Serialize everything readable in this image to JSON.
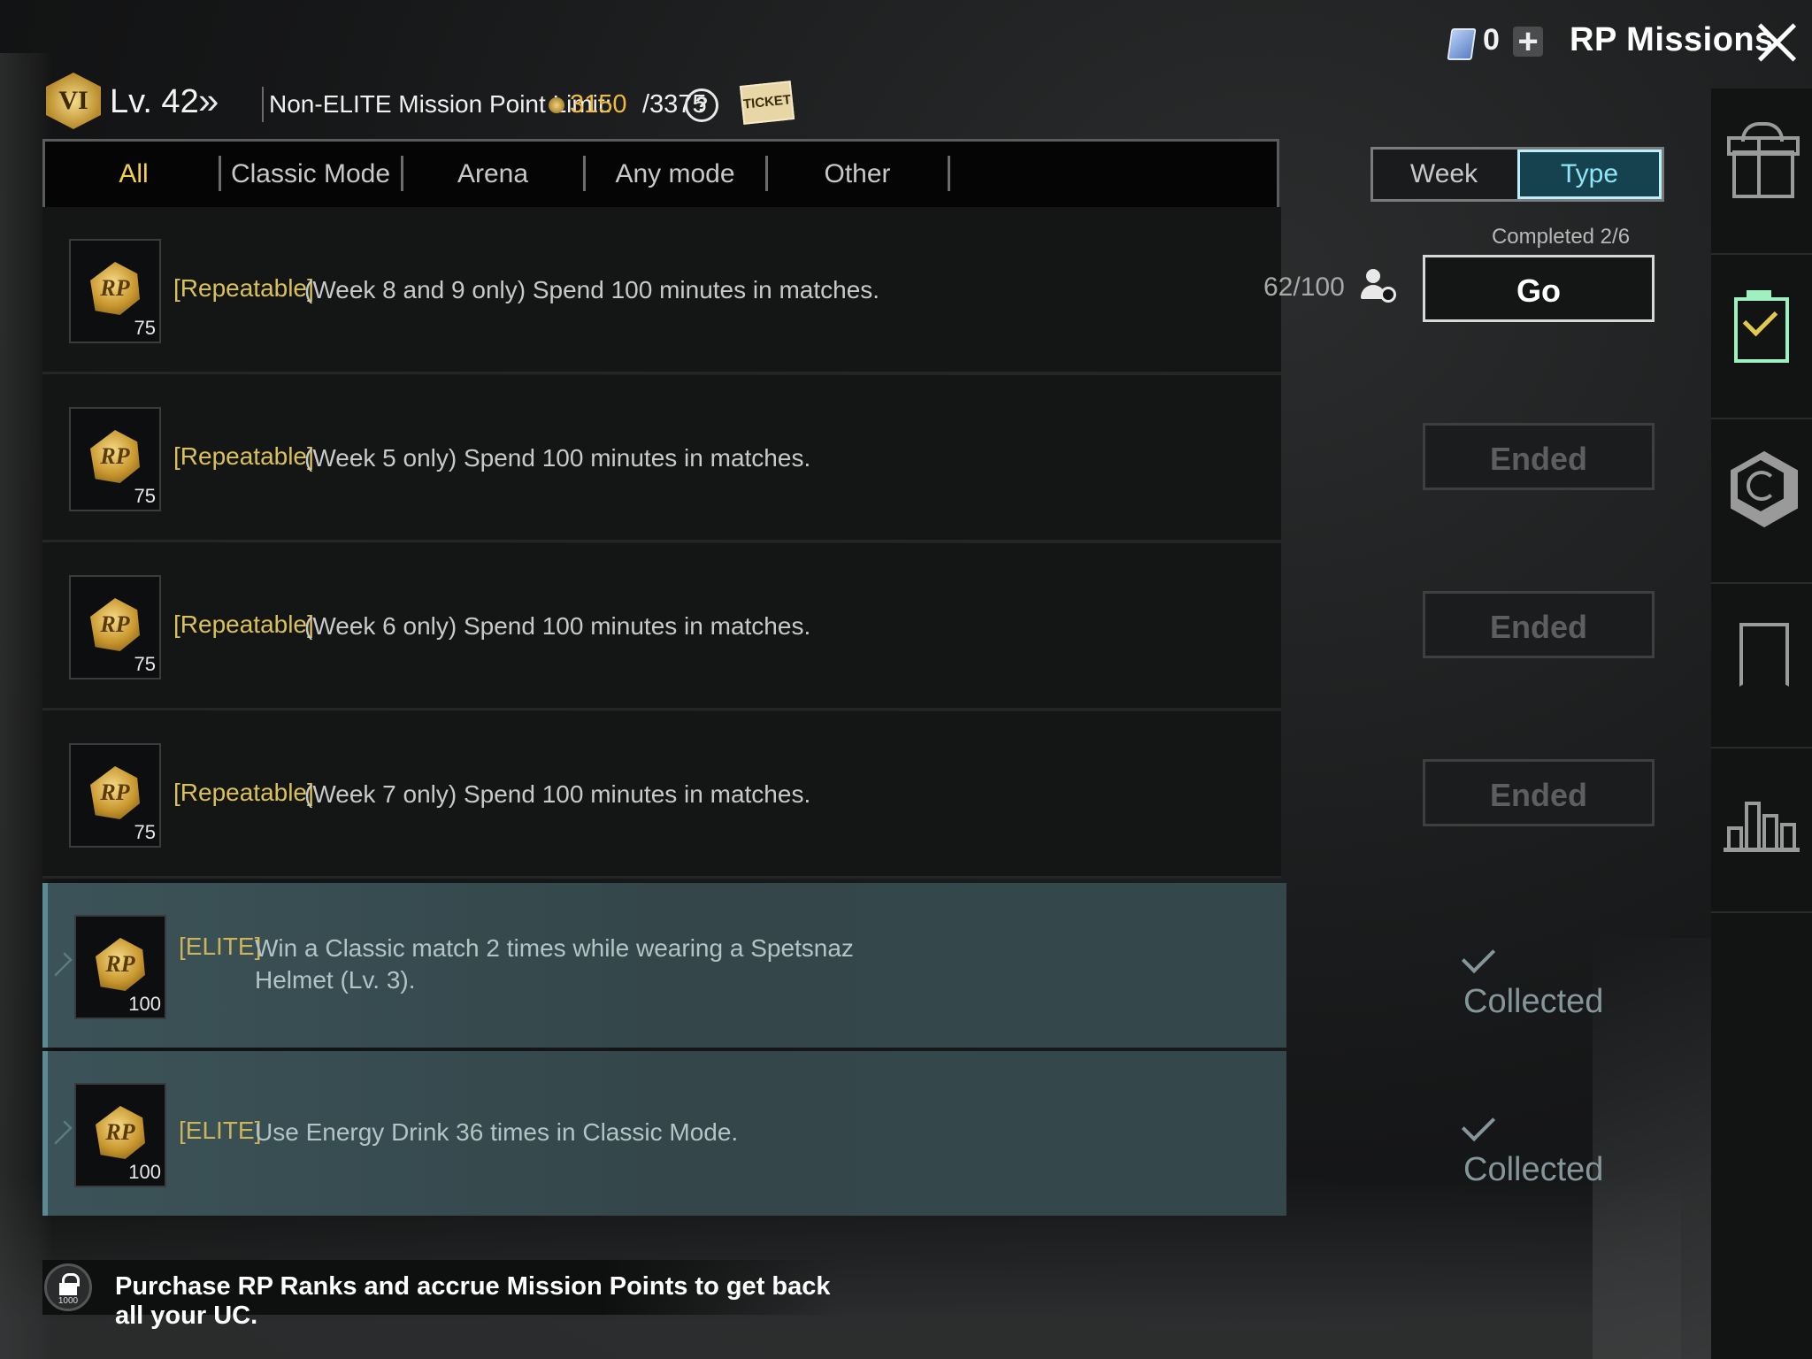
{
  "topbar": {
    "ticket_count": "0",
    "plus_label": "+",
    "title": "RP Missions"
  },
  "header": {
    "rank_badge": "VI",
    "level": "Lv. 42",
    "limit_label": "Non-ELITE Mission Point Limit:",
    "limit_current": "3150",
    "limit_max": "/3375",
    "help_label": "?",
    "ticket_label": "TICKET"
  },
  "tabs": [
    {
      "label": "All",
      "active": true
    },
    {
      "label": "Classic Mode",
      "active": false
    },
    {
      "label": "Arena",
      "active": false
    },
    {
      "label": "Any mode",
      "active": false
    },
    {
      "label": "Other",
      "active": false
    }
  ],
  "sort_toggle": {
    "week": "Week",
    "type": "Type",
    "selected": "Type"
  },
  "missions": [
    {
      "reward_icon": "rp-coin-icon",
      "reward_text": "RP",
      "reward_amount": "75",
      "tag": "[Repeatable]",
      "description": "(Week 8 and 9 only) Spend 100 minutes in matches.",
      "progress": "62/100",
      "status_note": "Completed 2/6",
      "action": "Go",
      "state": "go"
    },
    {
      "reward_icon": "rp-coin-icon",
      "reward_text": "RP",
      "reward_amount": "75",
      "tag": "[Repeatable]",
      "description": "(Week 5 only) Spend 100 minutes in matches.",
      "action": "Ended",
      "state": "ended"
    },
    {
      "reward_icon": "rp-coin-icon",
      "reward_text": "RP",
      "reward_amount": "75",
      "tag": "[Repeatable]",
      "description": "(Week 6 only) Spend 100 minutes in matches.",
      "action": "Ended",
      "state": "ended"
    },
    {
      "reward_icon": "rp-coin-icon",
      "reward_text": "RP",
      "reward_amount": "75",
      "tag": "[Repeatable]",
      "description": "(Week 7 only) Spend 100 minutes in matches.",
      "action": "Ended",
      "state": "ended"
    },
    {
      "reward_icon": "rp-coin-icon",
      "reward_text": "RP",
      "reward_amount": "100",
      "tag": "[ELITE]",
      "description": "Win a Classic match 2 times while wearing a Spetsnaz Helmet (Lv. 3).",
      "action": "Collected",
      "state": "collected"
    },
    {
      "reward_icon": "rp-coin-icon",
      "reward_text": "RP",
      "reward_amount": "100",
      "tag": "[ELITE]",
      "description": "Use Energy Drink 36 times in Classic Mode.",
      "action": "Collected",
      "state": "collected"
    }
  ],
  "sidebar": {
    "items": [
      {
        "icon": "gift-icon"
      },
      {
        "icon": "task-checklist-icon",
        "active": true
      },
      {
        "icon": "refresh-badge-icon"
      },
      {
        "icon": "bookmark-icon"
      },
      {
        "icon": "bar-chart-icon"
      }
    ]
  },
  "footer": {
    "lock_amount": "1000",
    "message": "Purchase RP Ranks and accrue Mission Points to get back all your UC."
  },
  "colors": {
    "accent_gold": "#f3d24a",
    "limit_gold": "#f0b93a",
    "tag_gold": "#d9c15a",
    "type_selected": "#8fe6f6",
    "elite_row_bg": "#3b5358"
  }
}
